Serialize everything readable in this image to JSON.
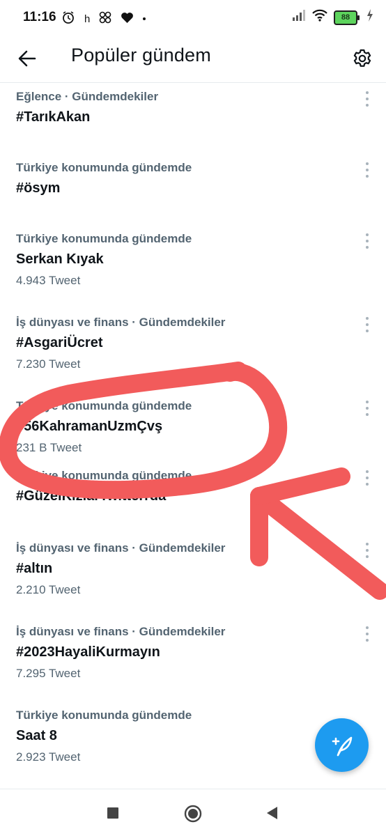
{
  "status_bar": {
    "time": "11:16",
    "left_icons": [
      "alarm-icon",
      "h",
      "pinwheel-icon",
      "heart-icon",
      "dot-icon"
    ],
    "battery_level": "88",
    "right_icons": [
      "signal-icon",
      "wifi-icon",
      "battery-icon",
      "charging-icon"
    ]
  },
  "header": {
    "title": "Popüler gündem",
    "back_icon": "arrow-left-icon",
    "settings_icon": "gear-icon"
  },
  "trends": [
    {
      "context": "Eğlence · Gündemdekiler",
      "name": "#TarıkAkan",
      "count": ""
    },
    {
      "context": "Türkiye konumunda gündemde",
      "name": "#ösym",
      "count": ""
    },
    {
      "context": "Türkiye konumunda gündemde",
      "name": "Serkan Kıyak",
      "count": "4.943 Tweet"
    },
    {
      "context": "İş dünyası ve finans · Gündemdekiler",
      "name": "#AsgariÜcret",
      "count": "7.230 Tweet"
    },
    {
      "context": "Türkiye konumunda gündemde",
      "name": "#56KahramanUzmÇvş",
      "count": "231 B Tweet"
    },
    {
      "context": "Türkiye konumunda gündemde",
      "name": "#GüzelKızlarTwitterrda",
      "count": ""
    },
    {
      "context": "İş dünyası ve finans · Gündemdekiler",
      "name": "#altın",
      "count": "2.210 Tweet"
    },
    {
      "context": "İş dünyası ve finans · Gündemdekiler",
      "name": "#2023HayaliKurmayın",
      "count": "7.295 Tweet"
    },
    {
      "context": "Türkiye konumunda gündemde",
      "name": "Saat 8",
      "count": "2.923 Tweet"
    }
  ],
  "fab": {
    "icon": "compose-feather-icon"
  },
  "nav_bar": {
    "icons": [
      "recents-square-icon",
      "home-circle-icon",
      "back-triangle-icon"
    ]
  },
  "annotation": {
    "color": "#f25b5b",
    "shapes": [
      "circle-around-trend",
      "arrow-pointing-to-trend"
    ]
  }
}
